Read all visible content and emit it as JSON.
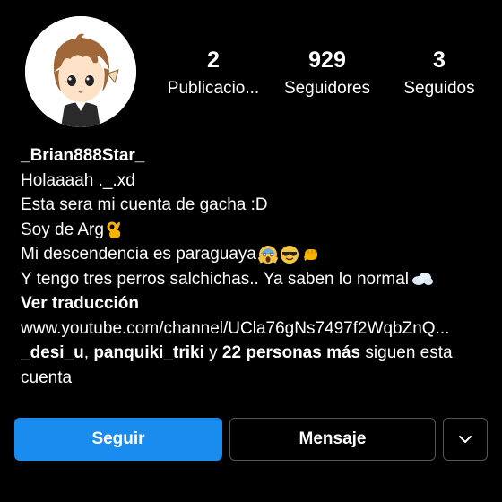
{
  "profile": {
    "username": "_Brian888Star_",
    "stats": [
      {
        "count": "2",
        "label": "Publicacio..."
      },
      {
        "count": "929",
        "label": "Seguidores"
      },
      {
        "count": "3",
        "label": "Seguidos"
      }
    ]
  },
  "bio": {
    "lines": [
      "Holaaaah ._.xd",
      "Esta sera mi cuenta de gacha :D",
      "Soy de Arg",
      "Mi descendencia es paraguaya",
      "Y tengo tres perros salchichas.. Ya saben lo normal"
    ],
    "emoji": {
      "line3": [
        "ok-hand-icon"
      ],
      "line4": [
        "screaming-face-icon",
        "sunglasses-face-icon",
        "fist-icon"
      ],
      "line5": [
        "cloud-icon"
      ]
    },
    "translate": "Ver traducción",
    "link": "www.youtube.com/channel/UCla76gNs7497f2WqbZnQ...",
    "followed_by": {
      "user1": "_desi_u",
      "sep": ",",
      "user2": "panquiki_triki",
      "and": "y",
      "others": "22 personas más",
      "tail1": "siguen esta",
      "tail2": "cuenta"
    }
  },
  "actions": {
    "follow": "Seguir",
    "message": "Mensaje"
  },
  "colors": {
    "background": "#000000",
    "follow_button": "#1a8cf0",
    "button_border": "#555555"
  }
}
